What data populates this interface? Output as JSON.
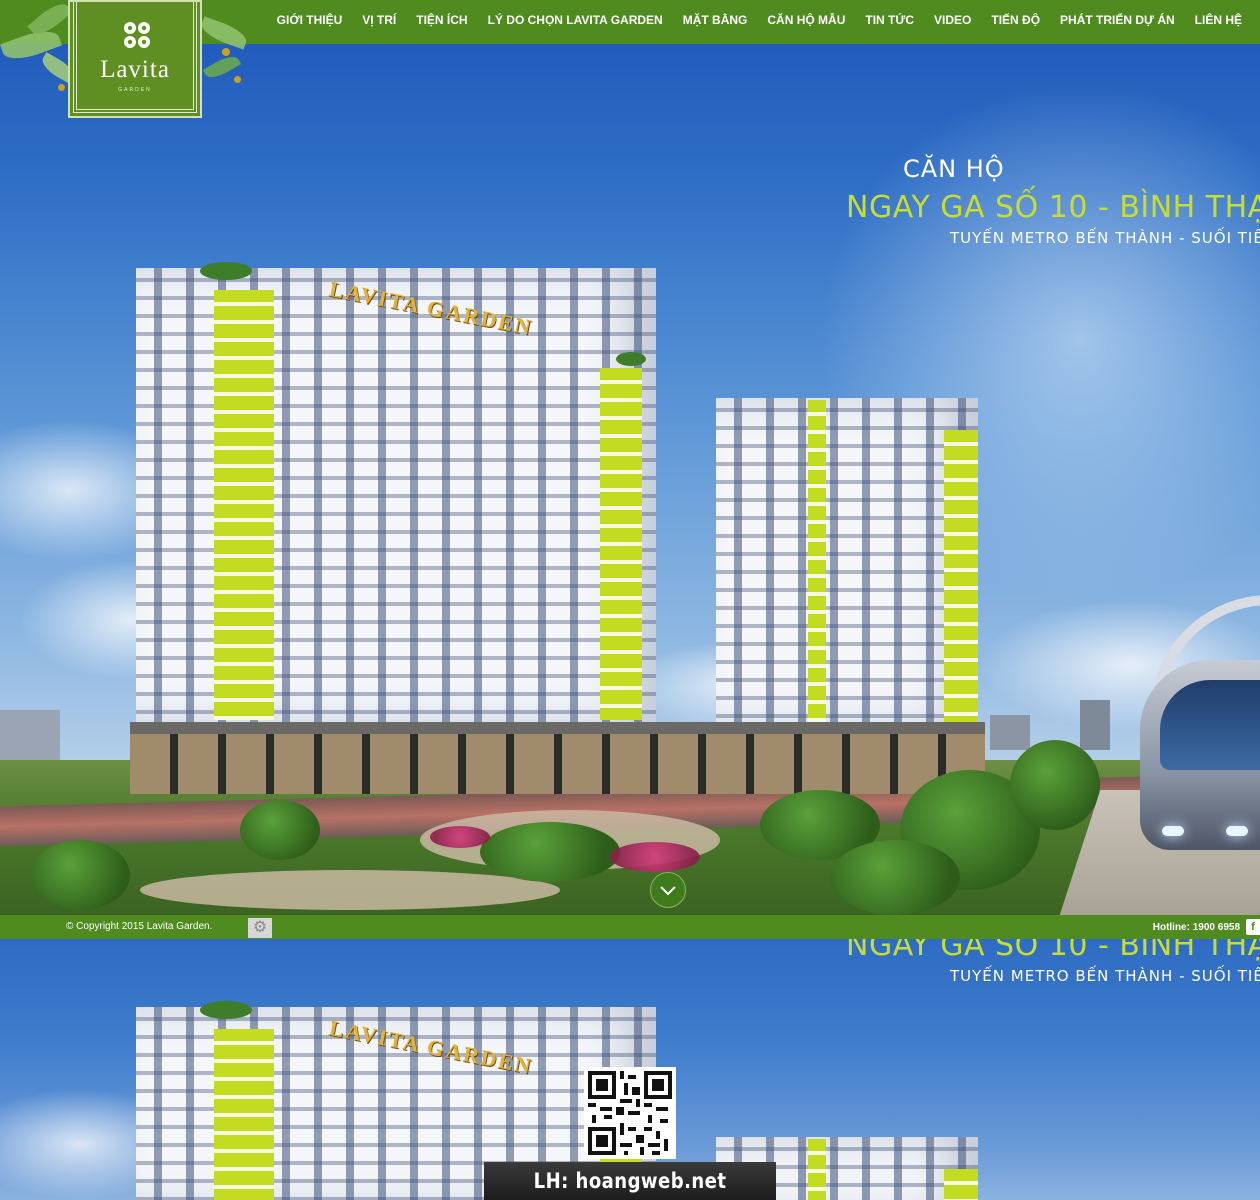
{
  "logo": {
    "name": "Lavita",
    "sub": "GARDEN"
  },
  "nav": {
    "items": [
      "GIỚI THIỆU",
      "VỊ TRÍ",
      "TIỆN ÍCH",
      "LÝ DO CHỌN LAVITA GARDEN",
      "MẶT BẰNG",
      "CĂN HỘ MẪU",
      "TIN TỨC",
      "VIDEO",
      "TIẾN ĐỘ",
      "PHÁT TRIỂN DỰ ÁN",
      "LIÊN HỆ"
    ]
  },
  "hero": {
    "line1": "CĂN HỘ",
    "line2": "NGAY GA SỐ 10 - BÌNH THẠ",
    "line3": "TUYẾN METRO BẾN THÀNH - SUỐI TIÊN",
    "building_sign": "LAVITA GARDEN",
    "scroll_icon": "chevron-down-icon"
  },
  "footer": {
    "copyright": "© Copyright 2015 Lavita Garden.",
    "hotline": "Hotline: 1900 6958",
    "social_icon": "facebook-icon",
    "widget_icon": "gear-icon"
  },
  "hero2": {
    "line1": "NGAY GA SỐ 10 - BÌNH THẠ",
    "line2": "TUYẾN METRO BẾN THÀNH - SUỐI TIÊN",
    "building_sign": "LAVITA GARDEN"
  },
  "overlay": {
    "qr_icon": "qr-code-icon",
    "contact": "LH: hoangweb.net"
  },
  "colors": {
    "brand_green": "#4f8b1e",
    "accent_lime": "#c7de2f",
    "logo_green": "#5f8f22"
  }
}
